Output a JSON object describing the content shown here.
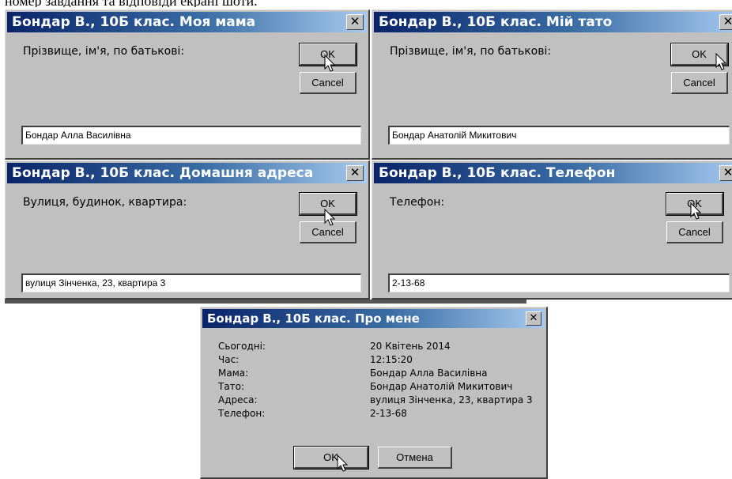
{
  "top_caption": "номер завдання та відповіди екрані шоти.",
  "dialogs": {
    "mama": {
      "title": "Бондар В., 10Б клас. Моя мама",
      "prompt": "Прізвище, ім'я, по батькові:",
      "ok": "OK",
      "cancel": "Cancel",
      "value": "Бондар Алла Василівна"
    },
    "tato": {
      "title": "Бондар В., 10Б клас. Мій тато",
      "prompt": "Прізвище, ім'я, по батькові:",
      "ok": "OK",
      "cancel": "Cancel",
      "value": "Бондар Анатолій Микитович"
    },
    "adresa": {
      "title": "Бондар В., 10Б клас. Домашня адреса",
      "prompt": "Вулиця, будинок, квартира:",
      "ok": "OK",
      "cancel": "Cancel",
      "value": "вулиця Зінченка, 23, квартира 3"
    },
    "telefon": {
      "title": "Бондар В., 10Б клас. Телефон",
      "prompt": "Телефон:",
      "ok": "OK",
      "cancel": "Cancel",
      "value": "2-13-68"
    },
    "pro_mene": {
      "title": "Бондар В., 10Б клас. Про мене",
      "rows": [
        {
          "label": "Сьогодні:",
          "value": "20 Квітень 2014"
        },
        {
          "label": "Час:",
          "value": "12:15:20"
        },
        {
          "label": "Мама:",
          "value": "Бондар Алла Василівна"
        },
        {
          "label": "Тато:",
          "value": "Бондар Анатолій Микитович"
        },
        {
          "label": "Адреса:",
          "value": "вулиця Зінченка, 23, квартира 3"
        },
        {
          "label": "Телефон:",
          "value": "2-13-68"
        }
      ],
      "ok": "OK",
      "cancel": "Отмена"
    }
  },
  "close_glyph": "✕",
  "icons": {
    "close": "close-icon",
    "cursor": "arrow-cursor-icon"
  }
}
